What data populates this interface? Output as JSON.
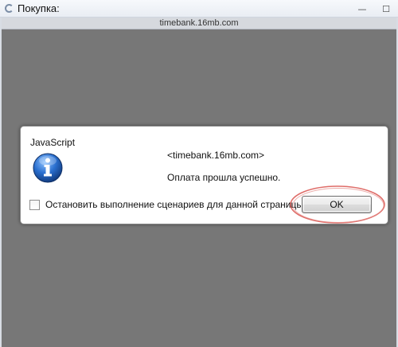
{
  "window": {
    "title": "Покупка:",
    "url": "timebank.16mb.com",
    "minimize_glyph": "—",
    "maximize_glyph": "☐"
  },
  "dialog": {
    "title": "JavaScript",
    "host": "<timebank.16mb.com>",
    "message": "Оплата прошла успешно.",
    "checkbox_label": "Остановить выполнение сценариев для данной страницы",
    "checkbox_checked": false,
    "ok_label": "OK",
    "icon": "info-icon"
  },
  "annotation": {
    "shape": "ellipse",
    "color": "#d9534f"
  }
}
